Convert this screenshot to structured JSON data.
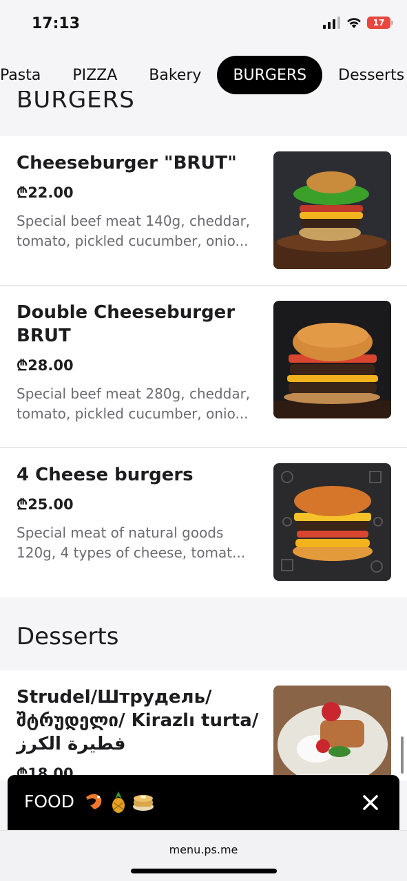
{
  "status_bar": {
    "time": "17:13",
    "battery_level": "17"
  },
  "tabs": [
    {
      "label": "Pasta",
      "active": false
    },
    {
      "label": "PIZZA",
      "active": false
    },
    {
      "label": "Bakery",
      "active": false
    },
    {
      "label": "BURGERS",
      "active": true
    },
    {
      "label": "Desserts",
      "active": false
    }
  ],
  "sections": {
    "burgers": {
      "title": "BURGERS",
      "items": [
        {
          "name": "Cheeseburger \"BRUT\"",
          "price": "₾22.00",
          "description_line1": "Special beef meat 140g, cheddar,",
          "description_line2": "tomato, pickled cucumber, onio..."
        },
        {
          "name_line1": "Double Cheeseburger",
          "name_line2": "BRUT",
          "price": "₾28.00",
          "description_line1": "Special beef meat 280g, cheddar,",
          "description_line2": "tomato, pickled cucumber, onio..."
        },
        {
          "name": "4 Cheese burgers",
          "price": "₾25.00",
          "description_line1": "Special meat of natural goods",
          "description_line2": "120g, 4 types of cheese, tomat..."
        }
      ]
    },
    "desserts": {
      "title": "Desserts",
      "items": [
        {
          "name_line1": "Strudel/Штрудель/",
          "name_line2": "შტრუდელი/ Kirazlı turta/",
          "name_line3": "فطيرة الكرز",
          "price": "₾18.00"
        }
      ]
    }
  },
  "promo_bar": {
    "label": "FOOD"
  },
  "url_bar": {
    "url": "menu.ps.me"
  }
}
